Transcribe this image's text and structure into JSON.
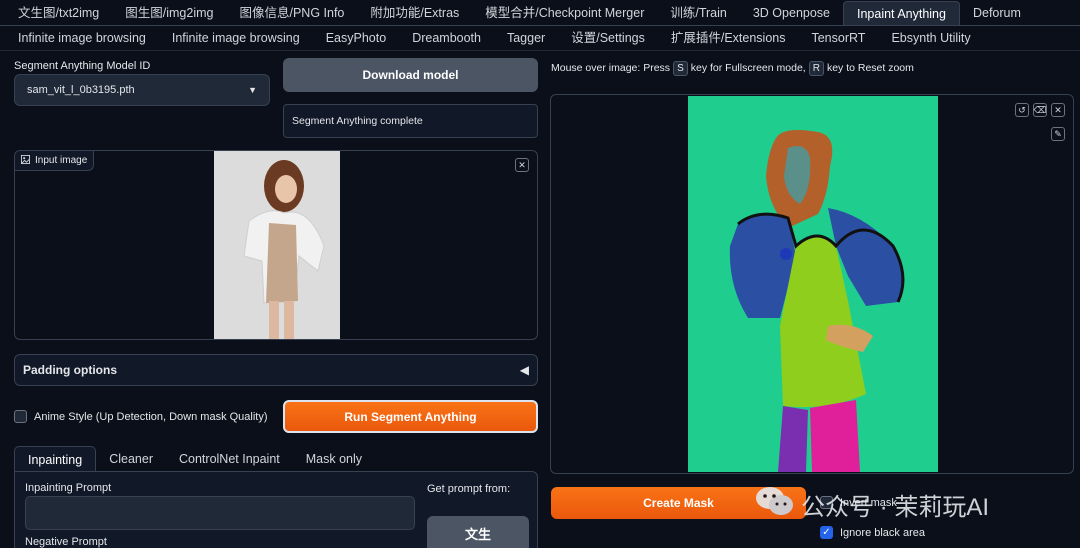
{
  "top_tabs": [
    {
      "label": "文生图/txt2img",
      "active": false
    },
    {
      "label": "图生图/img2img",
      "active": false
    },
    {
      "label": "图像信息/PNG Info",
      "active": false
    },
    {
      "label": "附加功能/Extras",
      "active": false
    },
    {
      "label": "模型合并/Checkpoint Merger",
      "active": false
    },
    {
      "label": "训练/Train",
      "active": false
    },
    {
      "label": "3D Openpose",
      "active": false
    },
    {
      "label": "Inpaint Anything",
      "active": true
    },
    {
      "label": "Deforum",
      "active": false
    }
  ],
  "top_tabs_row2": [
    {
      "label": "Infinite image browsing"
    },
    {
      "label": "Infinite image browsing"
    },
    {
      "label": "EasyPhoto"
    },
    {
      "label": "Dreambooth"
    },
    {
      "label": "Tagger"
    },
    {
      "label": "设置/Settings"
    },
    {
      "label": "扩展插件/Extensions"
    },
    {
      "label": "TensorRT"
    },
    {
      "label": "Ebsynth Utility"
    }
  ],
  "model": {
    "label": "Segment Anything Model ID",
    "value": "sam_vit_l_0b3195.pth"
  },
  "download_button": "Download model",
  "status_text": "Segment Anything complete",
  "input_image": {
    "label": "Input image"
  },
  "padding": {
    "label": "Padding options",
    "toggle_icon": "◀"
  },
  "anime_style": {
    "label": "Anime Style (Up Detection, Down mask Quality)",
    "checked": false
  },
  "run_button": "Run Segment Anything",
  "sub_tabs": [
    {
      "label": "Inpainting",
      "active": true
    },
    {
      "label": "Cleaner",
      "active": false
    },
    {
      "label": "ControlNet Inpaint",
      "active": false
    },
    {
      "label": "Mask only",
      "active": false
    }
  ],
  "inpainting": {
    "prompt_label": "Inpainting Prompt",
    "negative_label": "Negative Prompt",
    "get_prompt_label": "Get prompt from:",
    "get_prompt_button": "文生"
  },
  "hint": {
    "prefix": "Mouse over image: Press",
    "key1": "S",
    "mid": "key for Fullscreen mode,",
    "key2": "R",
    "suffix": "key to Reset zoom"
  },
  "create_mask_button": "Create Mask",
  "invert_mask": {
    "label": "Invert mask",
    "checked": false
  },
  "ignore_black": {
    "label": "Ignore black area",
    "checked": true
  },
  "watermark": {
    "text": "公众号 · 茉莉玩AI"
  },
  "colors": {
    "accent_orange": "#f97316",
    "mask_background": "#1fce8f",
    "checkbox_blue": "#2563eb"
  }
}
